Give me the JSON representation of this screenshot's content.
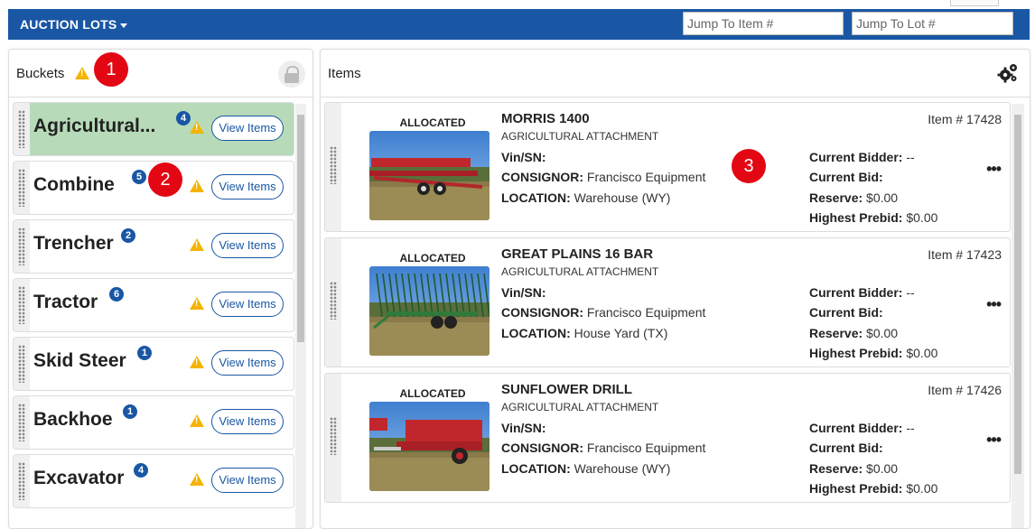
{
  "navbar": {
    "menu_label": "AUCTION LOTS",
    "jump_item_placeholder": "Jump To Item #",
    "jump_lot_placeholder": "Jump To Lot #",
    "bar_color": "#1957a4"
  },
  "buckets_panel": {
    "title": "Buckets",
    "warning_icon": "warning-icon",
    "lock_icon": "unlock-icon",
    "view_label": "View Items",
    "items": [
      {
        "name": "Agricultural...",
        "count": "4",
        "active": true
      },
      {
        "name": "Combine",
        "count": "5",
        "active": false
      },
      {
        "name": "Trencher",
        "count": "2",
        "active": false
      },
      {
        "name": "Tractor",
        "count": "6",
        "active": false
      },
      {
        "name": "Skid Steer",
        "count": "1",
        "active": false
      },
      {
        "name": "Backhoe",
        "count": "1",
        "active": false
      },
      {
        "name": "Excavator",
        "count": "4",
        "active": false
      }
    ]
  },
  "items_panel": {
    "title": "Items",
    "settings_icon": "gears-icon",
    "labels": {
      "allocated": "ALLOCATED",
      "vin": "Vin/SN:",
      "consignor": "CONSIGNOR:",
      "location": "LOCATION:",
      "current_bidder": "Current Bidder:",
      "current_bid": "Current Bid:",
      "reserve": "Reserve:",
      "highest_prebid": "Highest Prebid:",
      "more": "•••"
    },
    "items": [
      {
        "title": "MORRIS 1400",
        "category": "AGRICULTURAL ATTACHMENT",
        "vin": "",
        "consignor": "Francisco Equipment",
        "location": "Warehouse (WY)",
        "item_number": "Item # 17428",
        "current_bidder": "--",
        "current_bid": "",
        "reserve": "$0.00",
        "highest_prebid": "$0.00"
      },
      {
        "title": "GREAT PLAINS 16 BAR",
        "category": "AGRICULTURAL ATTACHMENT",
        "vin": "",
        "consignor": "Francisco Equipment",
        "location": "House Yard (TX)",
        "item_number": "Item # 17423",
        "current_bidder": "--",
        "current_bid": "",
        "reserve": "$0.00",
        "highest_prebid": "$0.00"
      },
      {
        "title": "SUNFLOWER DRILL",
        "category": "AGRICULTURAL ATTACHMENT",
        "vin": "",
        "consignor": "Francisco Equipment",
        "location": "Warehouse (WY)",
        "item_number": "Item # 17426",
        "current_bidder": "--",
        "current_bid": "",
        "reserve": "$0.00",
        "highest_prebid": "$0.00"
      }
    ]
  },
  "callouts": [
    "1",
    "2",
    "3"
  ]
}
